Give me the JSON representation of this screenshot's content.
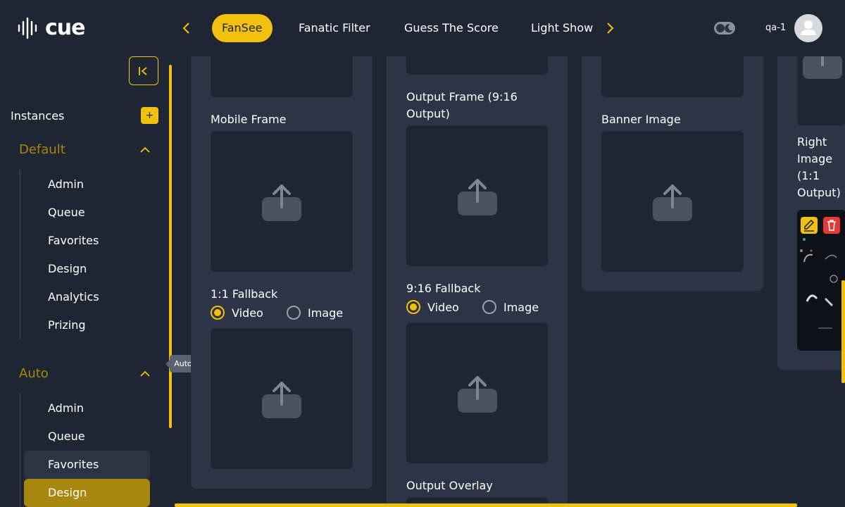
{
  "app": {
    "logo_text": "cue",
    "logo_icon": "soundwave-logo-icon"
  },
  "header": {
    "tabs": [
      {
        "label": "FanSee",
        "active": true
      },
      {
        "label": "Fanatic Filter",
        "active": false
      },
      {
        "label": "Guess The Score",
        "active": false
      },
      {
        "label": "Light Show",
        "active": false
      }
    ],
    "user_name": "qa-1"
  },
  "sidebar": {
    "instances_label": "Instances",
    "add_label": "+",
    "groups": [
      {
        "title": "Default",
        "items": [
          "Admin",
          "Queue",
          "Favorites",
          "Design",
          "Analytics",
          "Prizing"
        ]
      },
      {
        "title": "Auto",
        "items": [
          "Admin",
          "Queue",
          "Favorites",
          "Design"
        ]
      }
    ],
    "tooltip": "Auto"
  },
  "main": {
    "col1": {
      "mobile_frame_label": "Mobile Frame",
      "fallback_label": "1:1 Fallback",
      "radio_video": "Video",
      "radio_image": "Image",
      "selected": "Video"
    },
    "col2": {
      "output_frame_label": "Output Frame (9:16 Output)",
      "fallback_label": "9:16 Fallback",
      "radio_video": "Video",
      "radio_image": "Image",
      "selected": "Video",
      "output_overlay_label": "Output Overlay"
    },
    "col3": {
      "banner_label": "Banner Image"
    },
    "col4": {
      "right_image_label": "Right Image (1:1 Output)"
    }
  },
  "colors": {
    "accent": "#f2c00f",
    "accent_dark": "#a8860f",
    "bg": "#1f2633",
    "card": "#2b3546",
    "danger": "#e53935"
  }
}
